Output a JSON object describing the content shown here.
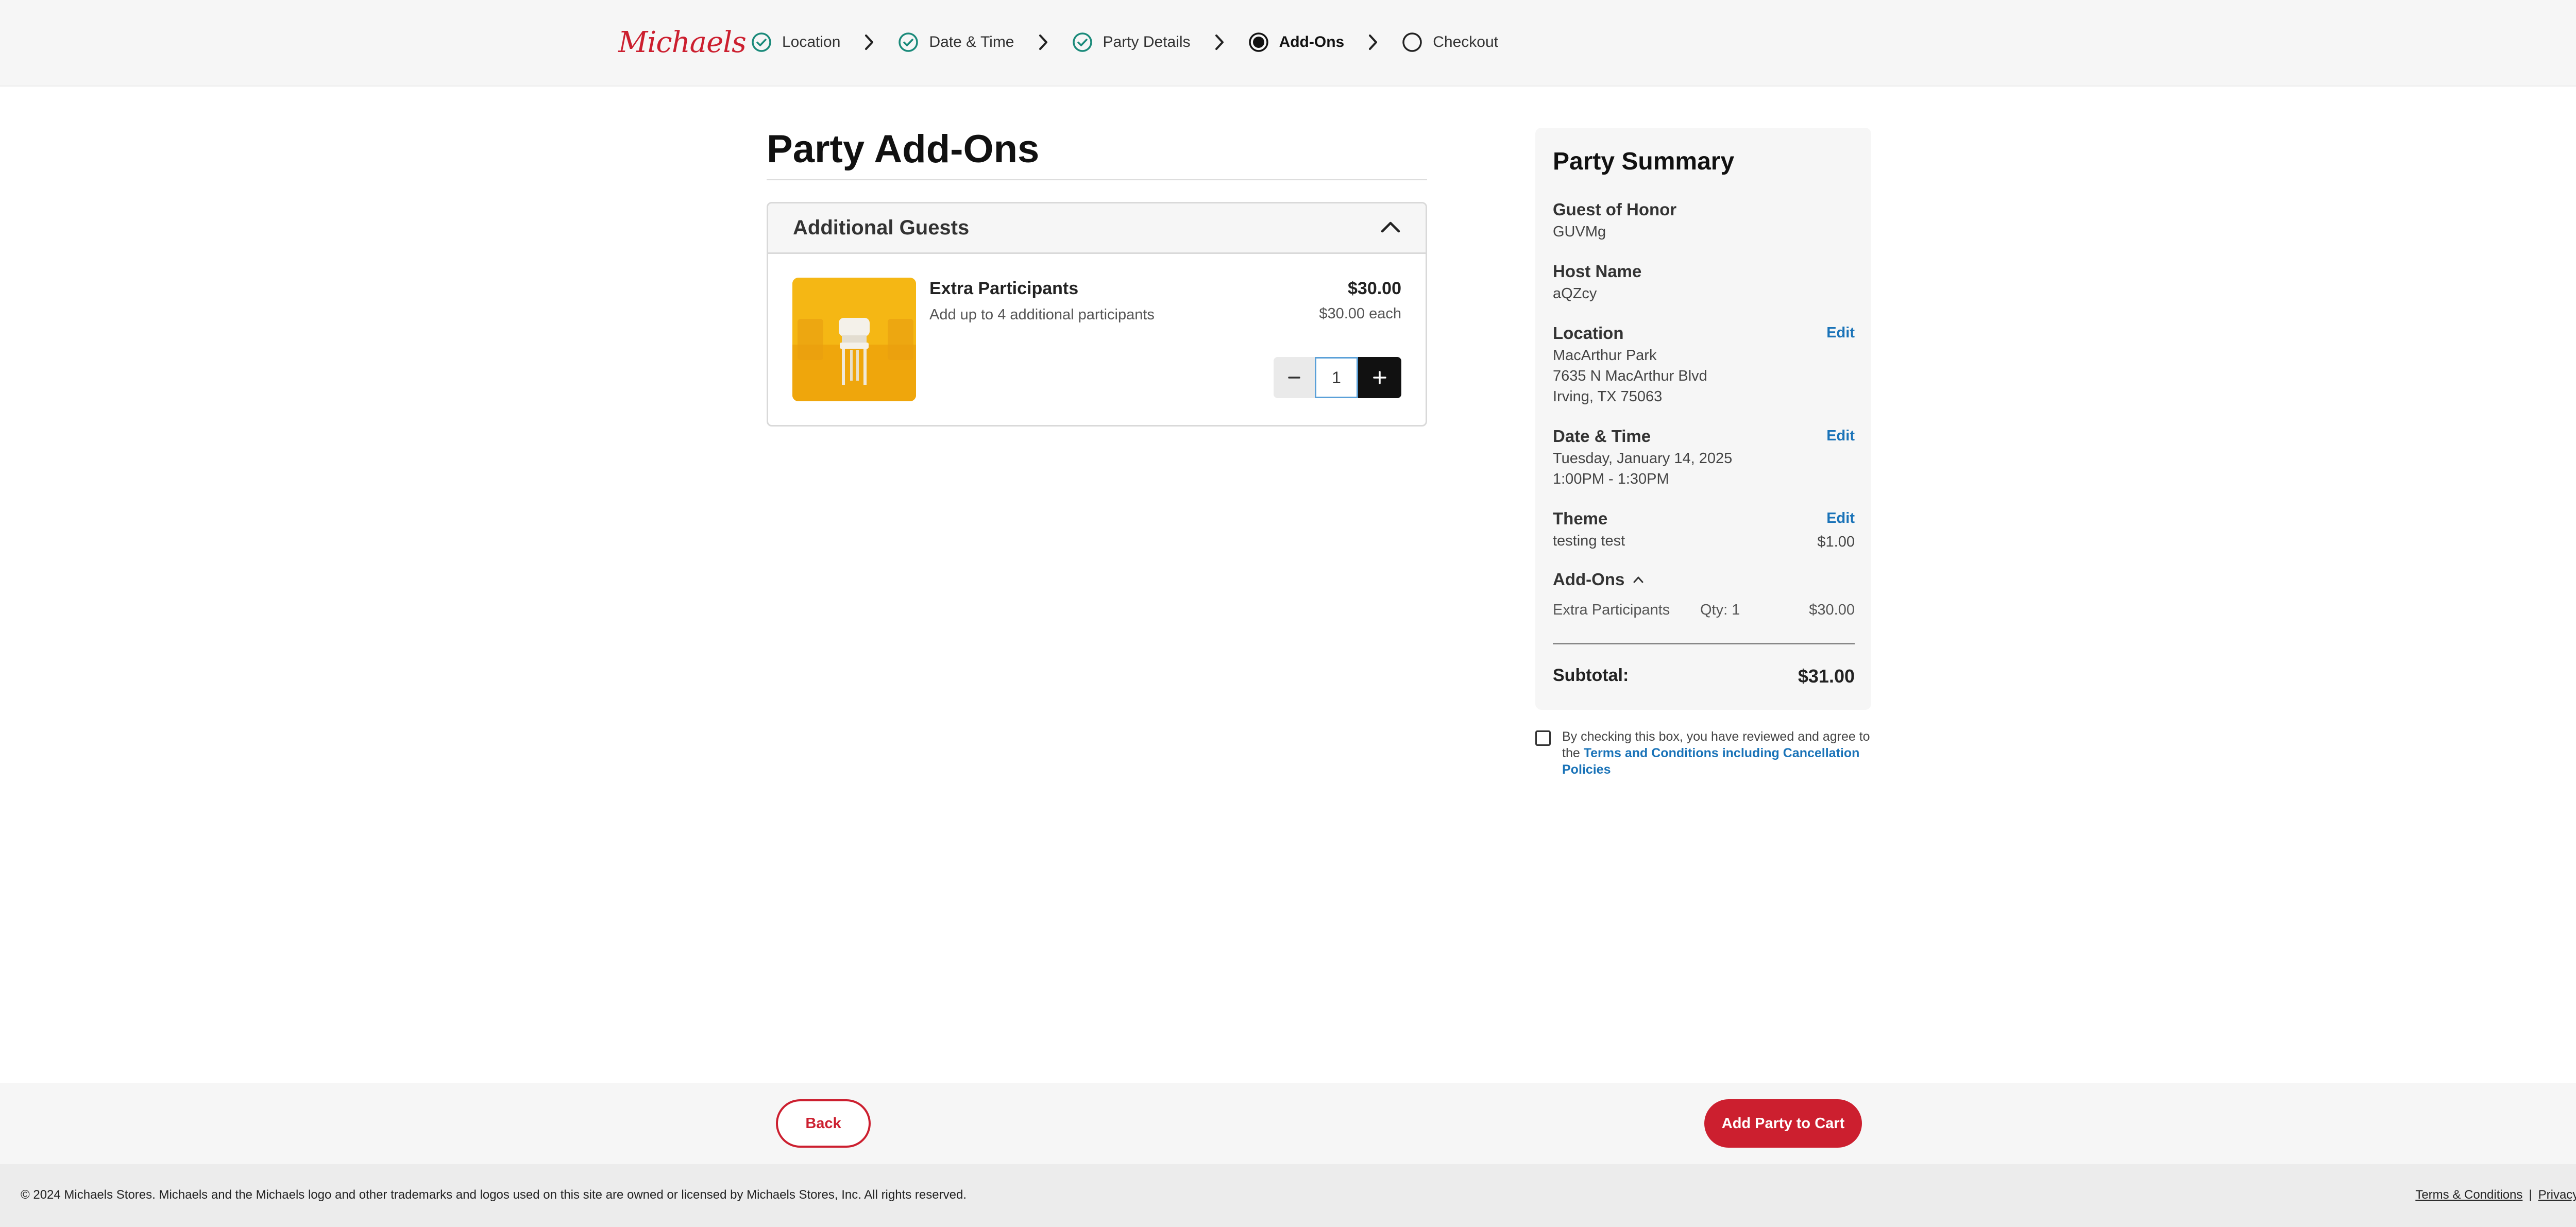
{
  "header": {
    "logo_text": "Michaels",
    "steps": [
      {
        "label": "Location",
        "state": "complete"
      },
      {
        "label": "Date & Time",
        "state": "complete"
      },
      {
        "label": "Party Details",
        "state": "complete"
      },
      {
        "label": "Add-Ons",
        "state": "current"
      },
      {
        "label": "Checkout",
        "state": "upcoming"
      }
    ]
  },
  "main": {
    "title": "Party Add-Ons",
    "accordion": {
      "title": "Additional Guests",
      "item": {
        "name": "Extra Participants",
        "description": "Add up to 4 additional participants",
        "total_price": "$30.00",
        "unit_price": "$30.00 each",
        "quantity": "1"
      }
    }
  },
  "summary": {
    "title": "Party Summary",
    "guest_of_honor_label": "Guest of Honor",
    "guest_of_honor": "GUVMg",
    "host_name_label": "Host Name",
    "host_name": "aQZcy",
    "location_label": "Location",
    "location_line1": "MacArthur Park",
    "location_line2": "7635 N MacArthur Blvd",
    "location_line3": "Irving, TX 75063",
    "date_time_label": "Date & Time",
    "date": "Tuesday, January 14, 2025",
    "time": "1:00PM - 1:30PM",
    "theme_label": "Theme",
    "theme": "testing test",
    "theme_price": "$1.00",
    "edit_label": "Edit",
    "addons_label": "Add-Ons",
    "addon_name": "Extra Participants",
    "addon_qty": "Qty: 1",
    "addon_price": "$30.00",
    "subtotal_label": "Subtotal:",
    "subtotal": "$31.00"
  },
  "terms": {
    "text": "By checking this box, you have reviewed and agree to the",
    "link": "Terms and Conditions including Cancellation Policies"
  },
  "actions": {
    "back": "Back",
    "add_to_cart": "Add Party to Cart"
  },
  "footer": {
    "copyright": "© 2024 Michaels Stores. Michaels and the Michaels logo and other trademarks and logos used on this site are owned or licensed by Michaels Stores, Inc. All rights reserved.",
    "terms_link": "Terms & Conditions",
    "separator": "|",
    "privacy_link": "Privacy Policy"
  },
  "colors": {
    "brand_red": "#cc1f2f",
    "check_teal": "#1a8a7a",
    "link_blue": "#1a73b8"
  }
}
